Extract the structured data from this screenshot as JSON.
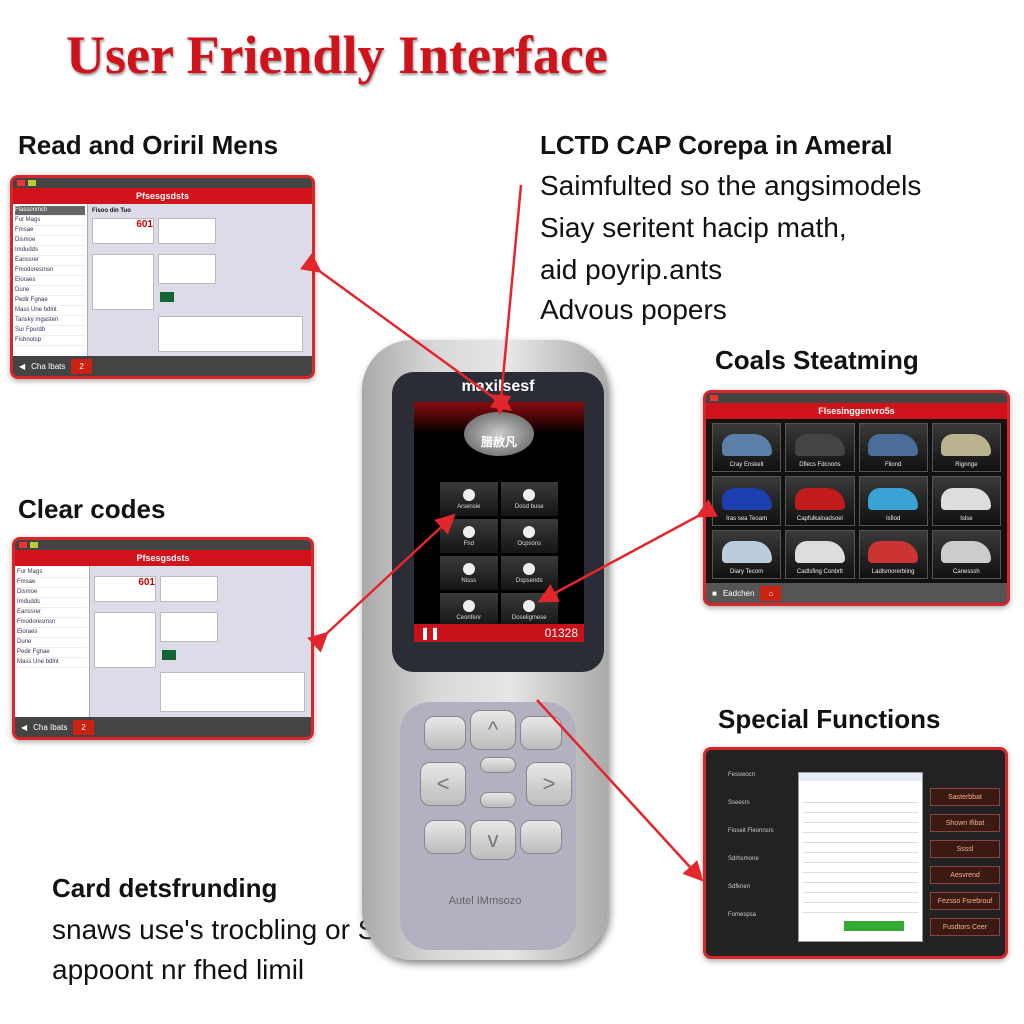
{
  "title": "User Friendly Interface",
  "colors": {
    "accent": "#d0121b",
    "arrow": "#e3262b"
  },
  "sections": {
    "read": {
      "heading": "Read and Oriril Mens"
    },
    "clear": {
      "heading": "Clear codes"
    },
    "lctd": {
      "heading": "LCTD CAP Corepa in Ameral",
      "lines": [
        "Saimfulted so the angsimodels",
        "Siay seritent hacip math,",
        "aid poyrip.ants",
        "Advous popers"
      ]
    },
    "coals": {
      "heading": "Coals Steatming"
    },
    "special": {
      "heading": "Special Functions"
    },
    "card": {
      "heading": "Card detsfrunding",
      "lines": [
        "snaws use's trocbling or SCA",
        "appoont nr fhed limil"
      ]
    }
  },
  "screen_codes": {
    "title": "Pfsesgsdsts",
    "side_header": "Flassonmch",
    "side_items": [
      "Fur Mags",
      "Fmsae",
      "Dismoe",
      "Imdudds",
      "Eanssrer",
      "Fmodoresmsn",
      "Eloraes",
      "Dune",
      "Pedir Fgnae",
      "Mass Une bdlnt",
      "Tansky mgasten",
      "Sur Fpurdb",
      "Fishnotsp"
    ],
    "main_header": "Fisoo din Tuo",
    "code": "601",
    "foot_label": "Cha Ibats",
    "foot_count": "2"
  },
  "screen_vehicles": {
    "title": "Flsesinggenvro5s",
    "tiles": [
      "Cray Enskelt",
      "Dflecs Fdcnons",
      "Fliond",
      "Rignnge",
      "Iras sea Teoam",
      "Capfulkaloadsoel",
      "Isfiod",
      "Islse",
      "Diary Tecom",
      "Cadlsfing Conbrlt",
      "Ladlsmorerbiing",
      "Canesssh"
    ],
    "foot_label": "Eadchen"
  },
  "screen_special": {
    "buttons": [
      "Sasterbbat",
      "Shown Ifibat",
      "Ssssl",
      "Aesvrend",
      "Fezsso Fsrebrouf",
      "Fusdtors Ceer"
    ],
    "side_items": [
      "Fesswocn",
      "Sseesrs",
      "Fioseit Fleonnsrs",
      "Sdrhsmone",
      "Sdfknen",
      "Fomespsa"
    ]
  },
  "device": {
    "brand": "maxilsesf",
    "header_label": "腊赦凡",
    "menu": [
      "Arsensie",
      "Dosd buse",
      "Fnd",
      "Ocpsons",
      "Nisss",
      "Dspsends",
      "Ceonfenr",
      "Doseligmese"
    ],
    "status_value": "01328",
    "footer_brand": "Autel IMmsozo"
  }
}
